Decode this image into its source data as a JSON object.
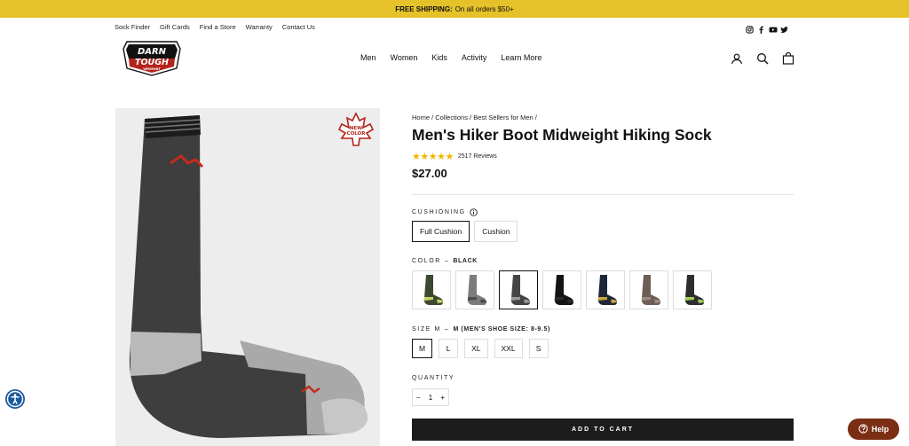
{
  "announcement": {
    "bold": "FREE SHIPPING:",
    "text": "On all orders $50+"
  },
  "utility_nav": [
    "Sock Finder",
    "Gift Cards",
    "Find a Store",
    "Warranty",
    "Contact Us"
  ],
  "social_icons": [
    "instagram-icon",
    "facebook-icon",
    "youtube-icon",
    "twitter-icon"
  ],
  "logo": {
    "line1": "DARN",
    "line2": "TOUGH",
    "line3": "VERMONT"
  },
  "main_nav": [
    "Men",
    "Women",
    "Kids",
    "Activity",
    "Learn More"
  ],
  "header_icons": [
    "account-icon",
    "search-icon",
    "cart-icon"
  ],
  "badge": {
    "line1": "NEW",
    "line2": "COLOR"
  },
  "product": {
    "breadcrumb": "Home / Collections / Best Sellers for Men /",
    "title": "Men's Hiker Boot Midweight Hiking Sock",
    "rating": 5,
    "stars": "★★★★★",
    "reviews": "2517 Reviews",
    "price": "$27.00"
  },
  "cushioning": {
    "label": "CUSHIONING",
    "options": [
      "Full Cushion",
      "Cushion"
    ],
    "selected": "Full Cushion"
  },
  "color": {
    "label": "COLOR",
    "sep": "–",
    "selected": "Black",
    "swatches": [
      {
        "name": "green",
        "body": "#3b4a2e",
        "accent": "#c8d26a"
      },
      {
        "name": "gray",
        "body": "#7c7c7c",
        "accent": "#4d4d4d"
      },
      {
        "name": "black",
        "body": "#444",
        "accent": "#999"
      },
      {
        "name": "black-solid",
        "body": "#141414",
        "accent": "#2a2a2a"
      },
      {
        "name": "navy",
        "body": "#1e2738",
        "accent": "#c9a640"
      },
      {
        "name": "taupe",
        "body": "#6d5f57",
        "accent": "#a08a80"
      },
      {
        "name": "charcoal",
        "body": "#2e2e2e",
        "accent": "#9ccf5a"
      }
    ]
  },
  "size": {
    "label": "SIZE M",
    "sep": "–",
    "detail": "M (MEN'S SHOE SIZE: 8-9.5)",
    "options": [
      "M",
      "L",
      "XL",
      "XXL",
      "S"
    ],
    "selected": "M"
  },
  "quantity": {
    "label": "QUANTITY",
    "minus": "−",
    "value": "1",
    "plus": "+"
  },
  "add_to_cart": "ADD TO CART",
  "help": "Help",
  "colors": {
    "announcement_bg": "#e5c12a",
    "help_bg": "#7a2e13",
    "cart_bg": "#1c1c1c",
    "star": "#f2b600"
  }
}
